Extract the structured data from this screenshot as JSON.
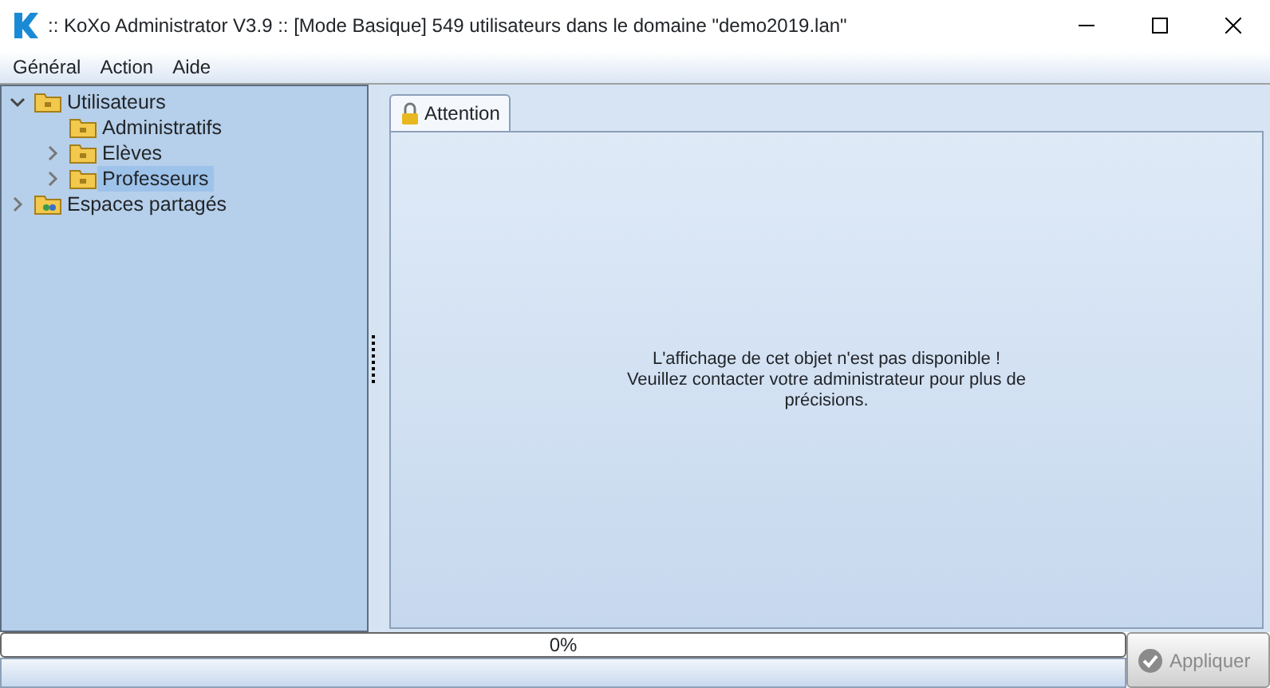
{
  "window": {
    "title": ":: KoXo Administrator V3.9 :: [Mode Basique] 549 utilisateurs dans le domaine \"demo2019.lan\""
  },
  "menu": [
    "Général",
    "Action",
    "Aide"
  ],
  "tree": [
    {
      "label": "Utilisateurs",
      "expanded": true,
      "selected": false,
      "kind": "folder",
      "children": [
        {
          "label": "Administratifs",
          "selected": false,
          "kind": "folder"
        },
        {
          "label": "Elèves",
          "expanded": false,
          "selected": false,
          "kind": "folder"
        },
        {
          "label": "Professeurs",
          "expanded": false,
          "selected": true,
          "kind": "folder"
        }
      ]
    },
    {
      "label": "Espaces partagés",
      "expanded": false,
      "selected": false,
      "kind": "shared"
    }
  ],
  "tabs": [
    {
      "label": "Attention",
      "selected": true
    }
  ],
  "message": [
    "L'affichage de cet objet n'est pas disponible !",
    "Veuillez contacter votre administrateur pour plus de précisions."
  ],
  "progress": {
    "level": 0,
    "reading": "0%"
  },
  "apply_button": {
    "label": "Appliquer",
    "disabled": true
  }
}
